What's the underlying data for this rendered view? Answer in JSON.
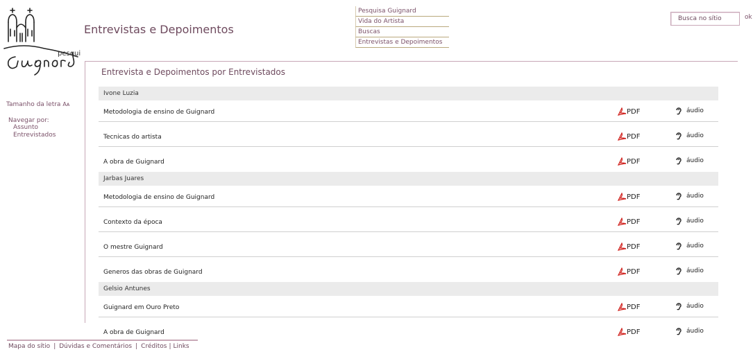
{
  "header": {
    "logo_text": "pesquisa",
    "logo_script": "Guignard",
    "page_title": "Entrevistas e Depoimentos"
  },
  "top_menu": [
    {
      "label": "Pesquisa Guignard"
    },
    {
      "label": "Vida do Artista"
    },
    {
      "label": "Buscas"
    },
    {
      "label": "Entrevistas e Depoimentos"
    }
  ],
  "search": {
    "value": "Busca no sítio",
    "ok_label": "ok"
  },
  "sidebar": {
    "font_size_label": "Tamanho da letra",
    "font_size_icon": "Aᴀ",
    "nav_heading": "Navegar por:",
    "nav_items": [
      {
        "label": "Assunto"
      },
      {
        "label": "Entrevistados"
      }
    ]
  },
  "content": {
    "title": "Entrevista e Depoimentos por Entrevistados",
    "pdf_label": "PDF",
    "audio_label": "áudio",
    "groups": [
      {
        "name": "Ivone Luzia",
        "rows": [
          "Metodologia de ensino de Guignard",
          "Tecnicas do artista",
          "A obra de Guignard"
        ]
      },
      {
        "name": "Jarbas Juares",
        "rows": [
          "Metodologia de ensino de Guignard",
          "Contexto da época",
          "O mestre Guignard",
          "Generos das obras de Guignard"
        ]
      },
      {
        "name": "Gelsio Antunes",
        "rows": [
          "Guignard em Ouro Preto",
          "A obra de Guignard"
        ]
      }
    ]
  },
  "footer": {
    "links": [
      "Mapa do sítio",
      "Dúvidas e Comentários",
      "Créditos",
      "Links"
    ]
  },
  "colors": {
    "accent": "#6e4a5e",
    "pdf_red": "#d0201c",
    "group_bg": "#ebebeb"
  }
}
